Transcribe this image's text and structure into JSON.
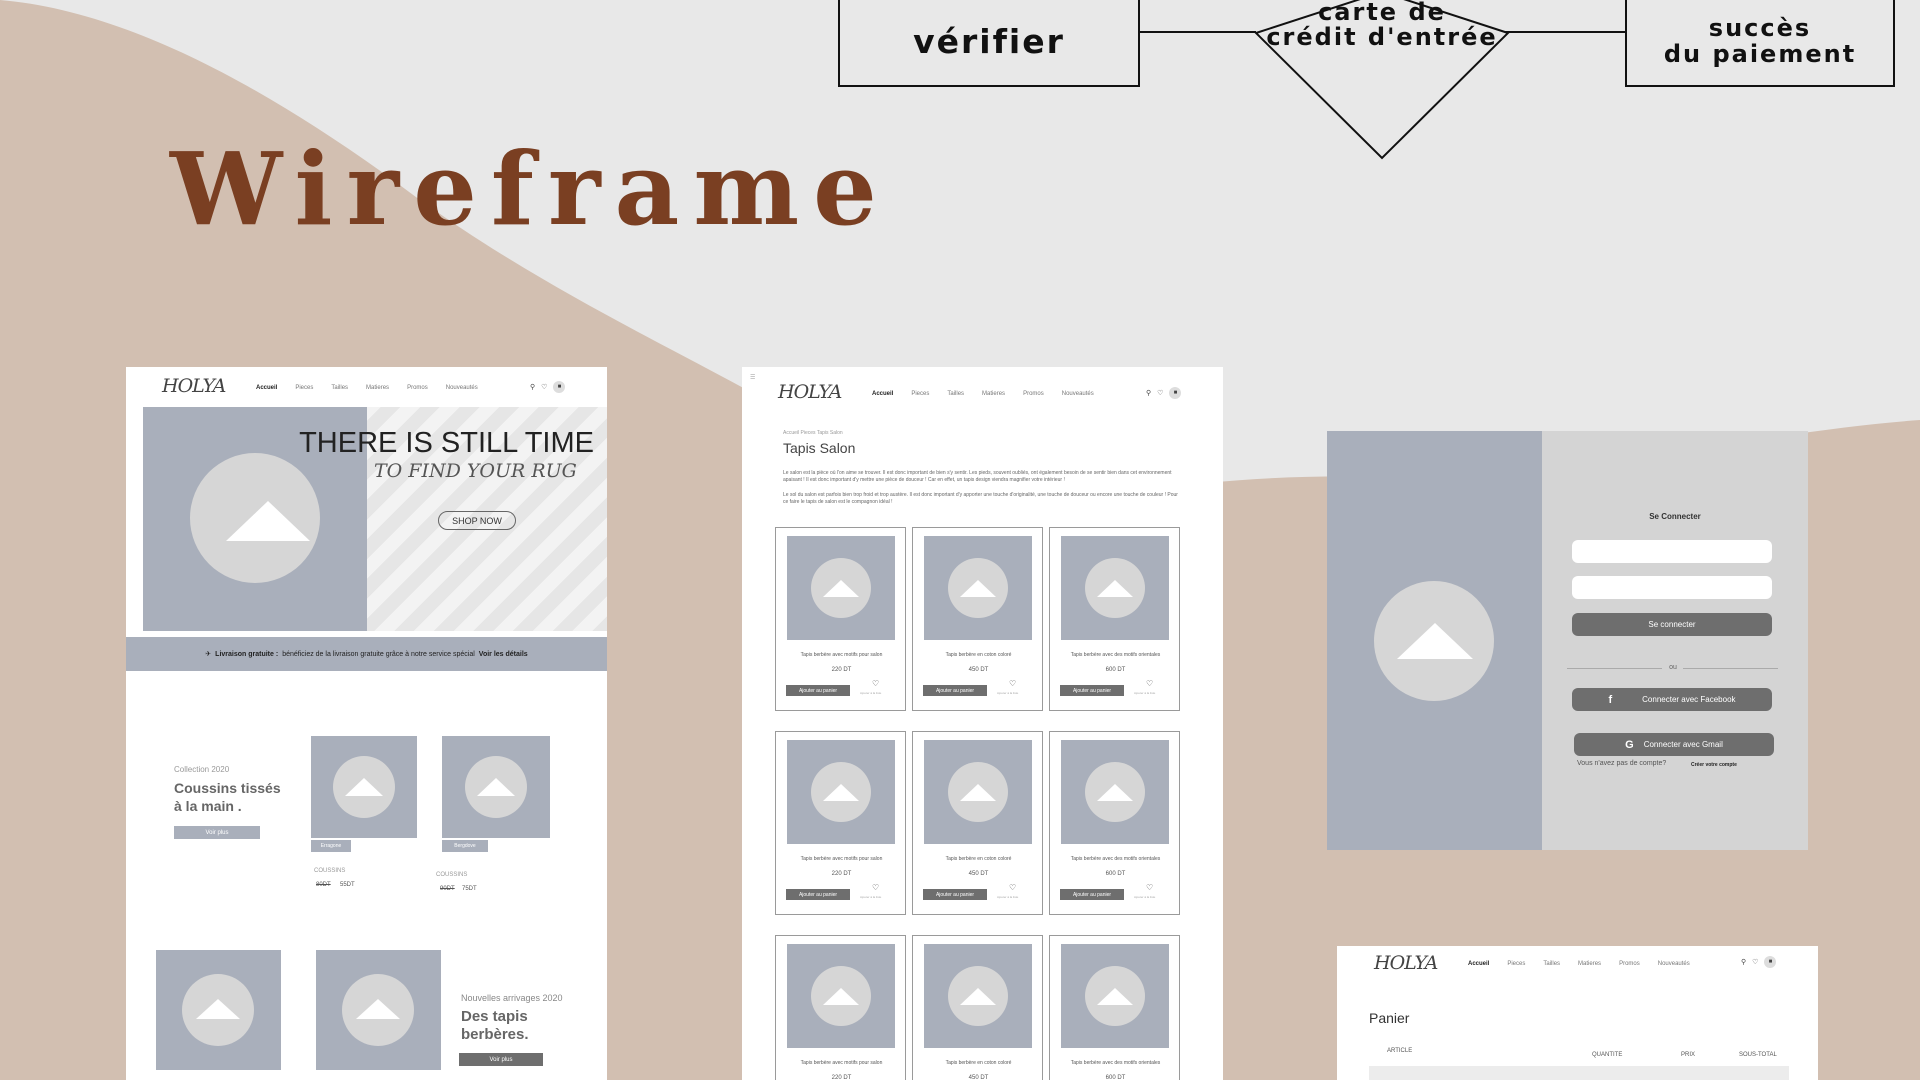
{
  "flow": {
    "verify": "vérifier",
    "card_line1": "carte de",
    "card_line2": "crédit d'entrée",
    "success_line1": "succès",
    "success_line2": "du paiement"
  },
  "title": "Wireframe",
  "brand": "HOLYA",
  "nav": [
    "Accueil",
    "Pieces",
    "Tailles",
    "Matieres",
    "Promos",
    "Nouveautés"
  ],
  "home": {
    "hero_title": "THERE IS STILL TIME",
    "hero_sub": "TO FIND YOUR RUG",
    "shop_now": "SHOP NOW",
    "banner_bold": "Livraison gratuite :",
    "banner_text": "bénéficiez de la livraison gratuite grâce à notre service spécial",
    "banner_link": "Voir les détails",
    "collection_label": "Collection 2020",
    "collection_title_1": "Coussins tissés",
    "collection_title_2": "à la main .",
    "voir_plus": "Voir plus",
    "tag1": "Erragone",
    "tag2": "Bergdove",
    "cat1": "COUSSINS",
    "old1": "80DT",
    "new1": "55DT",
    "cat2": "COUSSINS",
    "old2": "90DT",
    "new2": "75DT",
    "arrivals_label": "Nouvelles arrivages 2020",
    "arrivals_title_1": "Des tapis",
    "arrivals_title_2": "berbères."
  },
  "listing": {
    "breadcrumb": "Accueil Pieces Tapis Salon",
    "title": "Tapis Salon",
    "para1": "Le salon est la pièce où l'on aime se trouver. Il est donc important de bien s'y sentir. Les pieds, souvent oubliés, ont également besoin de se sentir bien dans cet environnement apaisant ! Il est donc important d'y mettre une pièce de douceur ! Car en effet, un tapis design viendra magnifier votre intérieur !",
    "para2": "Le sol du salon est parfois bien trop froid et trop austère. Il est donc important d'y apporter une touche d'originalité, une touche de douceur ou encore une touche de couleur ! Pour ce faire le tapis de salon est le compagnon idéal !",
    "add_to_cart": "Ajouter au panier",
    "wishlist": "Ajouter à la liste",
    "products": [
      {
        "name": "Tapis berbère avec motifs pour salon",
        "price": "220 DT"
      },
      {
        "name": "Tapis berbère en  coton  coloré",
        "price": "450 DT"
      },
      {
        "name": "Tapis berbère avec des motifs orientales",
        "price": "600 DT"
      }
    ]
  },
  "login": {
    "title": "Se Connecter",
    "button": "Se connecter",
    "or": "ou",
    "facebook": "Connecter avec Facebook",
    "gmail": "Connecter avec Gmail",
    "no_account": "Vous n'avez pas de compte?",
    "create": "Créer votre  compte"
  },
  "cart": {
    "title": "Panier",
    "col_article": "ARTICLE",
    "col_qty": "QUANTITE",
    "col_price": "PRIX",
    "col_sub": "SOUS-TOTAL"
  },
  "colors": {
    "background": "#e8e8e8",
    "wave": "#d2bfb1",
    "title": "#7a3f22",
    "placeholder": "#a9afbb"
  }
}
